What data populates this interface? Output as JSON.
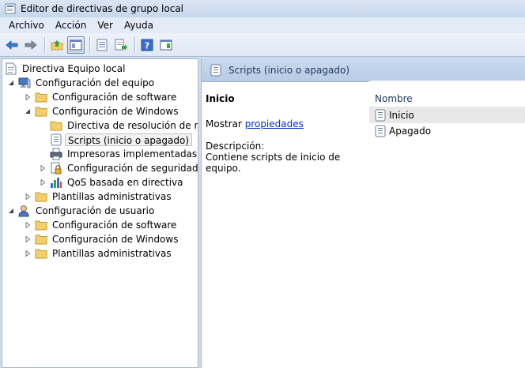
{
  "window": {
    "title": "Editor de directivas de grupo local"
  },
  "menu": [
    "Archivo",
    "Acción",
    "Ver",
    "Ayuda"
  ],
  "toolbar": {
    "icons": [
      "back-arrow-icon",
      "forward-arrow-icon",
      "up-folder-icon",
      "show-hide-tree-icon",
      "export-list-icon",
      "properties-icon",
      "help-icon",
      "show-hide-action-pane-icon"
    ]
  },
  "tree": {
    "root": "Directiva Equipo local",
    "computer": "Configuración del equipo",
    "comp_software": "Configuración de software",
    "comp_windows": "Configuración de Windows",
    "name_resolution": "Directiva de resolución de nombres",
    "scripts": "Scripts (inicio o apagado)",
    "printers": "Impresoras implementadas",
    "security": "Configuración de seguridad",
    "qos": "QoS basada en directiva",
    "comp_admin": "Plantillas administrativas",
    "user": "Configuración de usuario",
    "user_software": "Configuración de software",
    "user_windows": "Configuración de Windows",
    "user_admin": "Plantillas administrativas"
  },
  "details": {
    "header": "Scripts (inicio o apagado)",
    "selected_title": "Inicio",
    "show_prefix": "Mostrar ",
    "properties_link": "propiedades",
    "description_label": "Descripción:",
    "description_text": "Contiene scripts de inicio de equipo.",
    "column_name": "Nombre",
    "items": [
      "Inicio",
      "Apagado"
    ]
  },
  "colors": {
    "accent": "#1e395b",
    "link": "#0033cc",
    "folder": "#f2cf6b"
  }
}
